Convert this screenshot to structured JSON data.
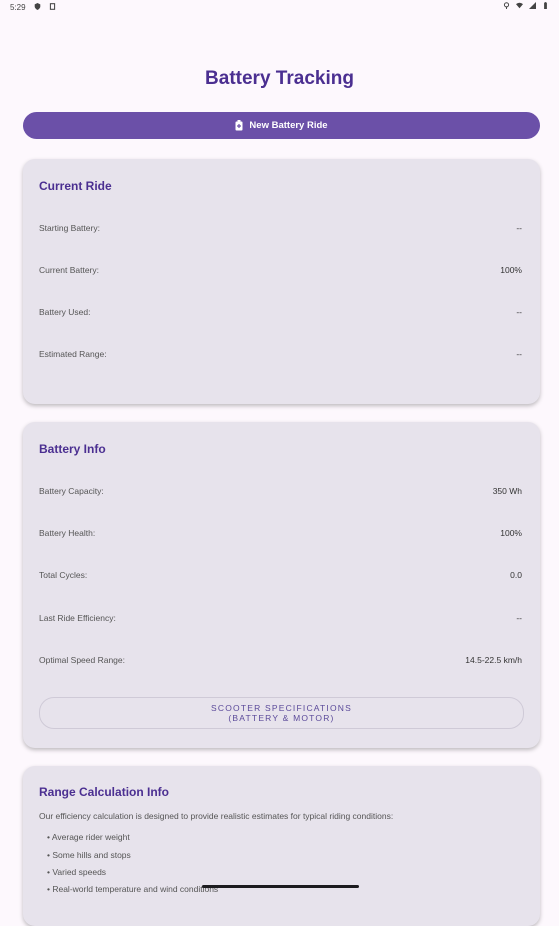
{
  "status_bar": {
    "time": "5:29"
  },
  "header": {
    "title": "Battery Tracking"
  },
  "new_ride_button": {
    "label": "New Battery Ride",
    "icon": "battery-add-icon"
  },
  "current_ride": {
    "title": "Current Ride",
    "rows": [
      {
        "label": "Starting Battery:",
        "value": "--"
      },
      {
        "label": "Current Battery:",
        "value": "100%"
      },
      {
        "label": "Battery Used:",
        "value": "--"
      },
      {
        "label": "Estimated Range:",
        "value": "--"
      }
    ]
  },
  "battery_info": {
    "title": "Battery Info",
    "rows": [
      {
        "label": "Battery Capacity:",
        "value": "350 Wh"
      },
      {
        "label": "Battery Health:",
        "value": "100%"
      },
      {
        "label": "Total Cycles:",
        "value": "0.0"
      },
      {
        "label": "Last Ride Efficiency:",
        "value": "--"
      },
      {
        "label": "Optimal Speed Range:",
        "value": "14.5-22.5 km/h"
      }
    ],
    "specs_button": {
      "line1": "SCOOTER SPECIFICATIONS",
      "line2": "(BATTERY & MOTOR)"
    }
  },
  "range_info": {
    "title": "Range Calculation Info",
    "intro": "Our efficiency calculation is designed to provide realistic estimates for typical riding conditions:",
    "bullets": [
      "Average rider weight",
      "Some hills and stops",
      "Varied speeds",
      "Real-world temperature and wind conditions"
    ]
  },
  "colors": {
    "accent": "#6b50a8",
    "title": "#4b2f91",
    "card": "#e7e3ec",
    "background": "#fdf8fd"
  }
}
